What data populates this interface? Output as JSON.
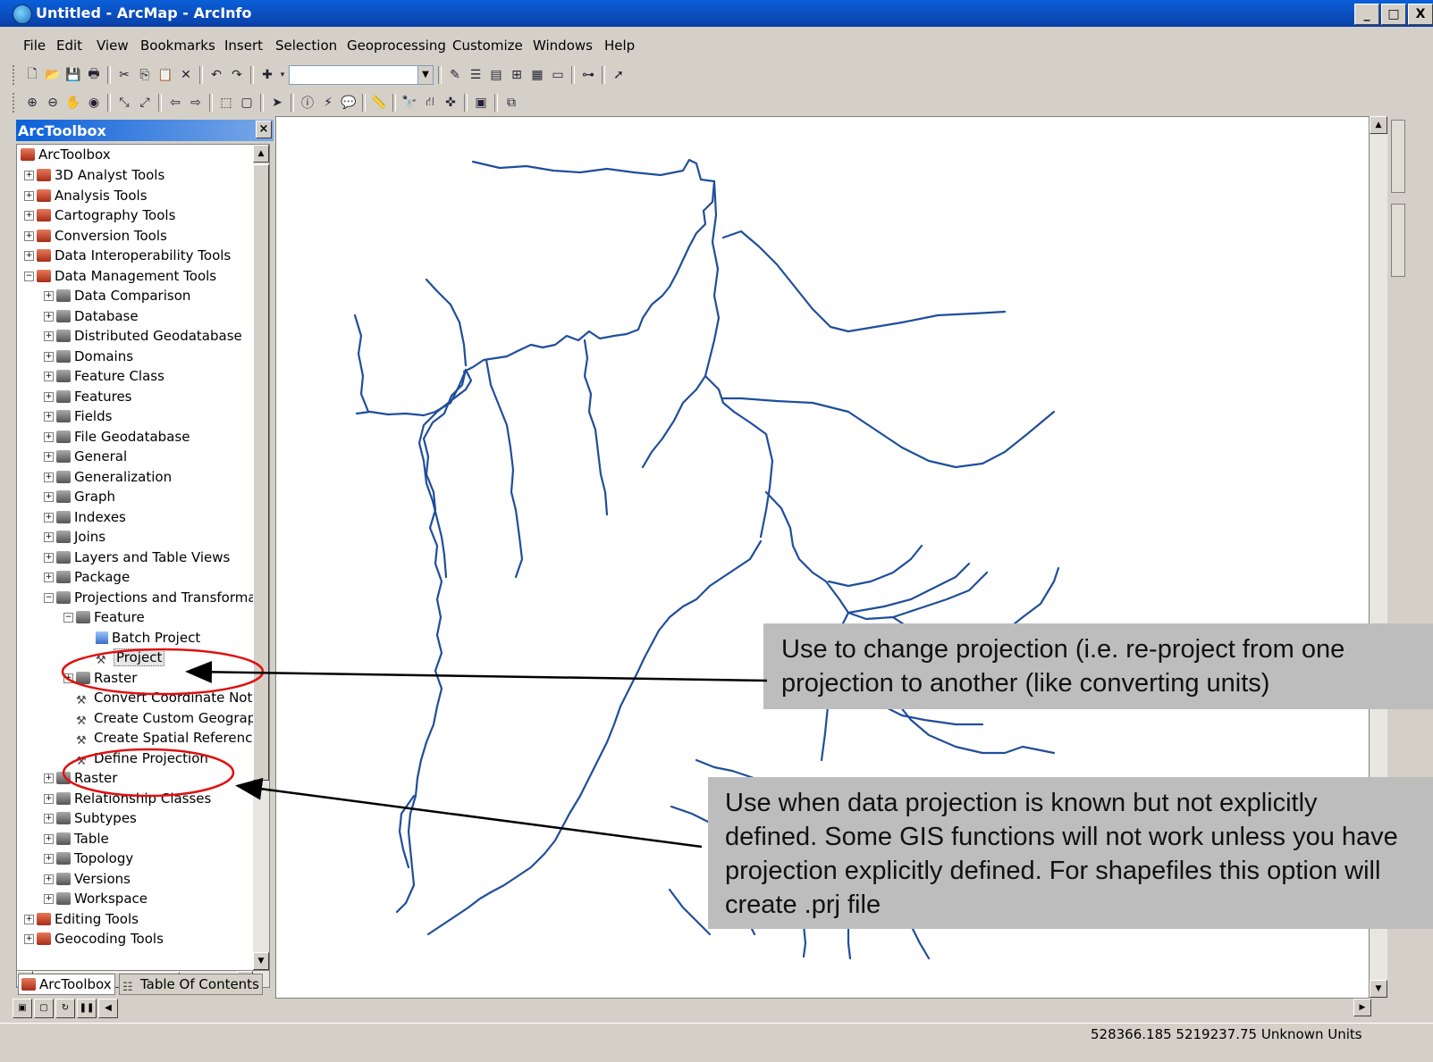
{
  "window": {
    "title": "Untitled - ArcMap - ArcInfo",
    "minimize": "_",
    "maximize": "□",
    "close": "X"
  },
  "menu": [
    "File",
    "Edit",
    "View",
    "Bookmarks",
    "Insert",
    "Selection",
    "Geoprocessing",
    "Customize",
    "Windows",
    "Help"
  ],
  "toolbox_panel": {
    "title": "ArcToolbox",
    "close": "×",
    "root": "ArcToolbox",
    "items": [
      {
        "label": "3D Analyst Tools",
        "level": 1,
        "kind": "toolbox",
        "exp": "+"
      },
      {
        "label": "Analysis Tools",
        "level": 1,
        "kind": "toolbox",
        "exp": "+"
      },
      {
        "label": "Cartography Tools",
        "level": 1,
        "kind": "toolbox",
        "exp": "+"
      },
      {
        "label": "Conversion Tools",
        "level": 1,
        "kind": "toolbox",
        "exp": "+"
      },
      {
        "label": "Data Interoperability Tools",
        "level": 1,
        "kind": "toolbox",
        "exp": "+"
      },
      {
        "label": "Data Management Tools",
        "level": 1,
        "kind": "toolbox",
        "exp": "−"
      },
      {
        "label": "Data Comparison",
        "level": 2,
        "kind": "toolset",
        "exp": "+"
      },
      {
        "label": "Database",
        "level": 2,
        "kind": "toolset",
        "exp": "+"
      },
      {
        "label": "Distributed Geodatabase",
        "level": 2,
        "kind": "toolset",
        "exp": "+"
      },
      {
        "label": "Domains",
        "level": 2,
        "kind": "toolset",
        "exp": "+"
      },
      {
        "label": "Feature Class",
        "level": 2,
        "kind": "toolset",
        "exp": "+"
      },
      {
        "label": "Features",
        "level": 2,
        "kind": "toolset",
        "exp": "+"
      },
      {
        "label": "Fields",
        "level": 2,
        "kind": "toolset",
        "exp": "+"
      },
      {
        "label": "File Geodatabase",
        "level": 2,
        "kind": "toolset",
        "exp": "+"
      },
      {
        "label": "General",
        "level": 2,
        "kind": "toolset",
        "exp": "+"
      },
      {
        "label": "Generalization",
        "level": 2,
        "kind": "toolset",
        "exp": "+"
      },
      {
        "label": "Graph",
        "level": 2,
        "kind": "toolset",
        "exp": "+"
      },
      {
        "label": "Indexes",
        "level": 2,
        "kind": "toolset",
        "exp": "+"
      },
      {
        "label": "Joins",
        "level": 2,
        "kind": "toolset",
        "exp": "+"
      },
      {
        "label": "Layers and Table Views",
        "level": 2,
        "kind": "toolset",
        "exp": "+"
      },
      {
        "label": "Package",
        "level": 2,
        "kind": "toolset",
        "exp": "+"
      },
      {
        "label": "Projections and Transforma",
        "level": 2,
        "kind": "toolset",
        "exp": "−"
      },
      {
        "label": "Feature",
        "level": 3,
        "kind": "toolset",
        "exp": "−"
      },
      {
        "label": "Batch Project",
        "level": 4,
        "kind": "batch",
        "exp": ""
      },
      {
        "label": "Project",
        "level": 4,
        "kind": "tool",
        "exp": "",
        "selected": true
      },
      {
        "label": "Raster",
        "level": 3,
        "kind": "toolset",
        "exp": "+"
      },
      {
        "label": "Convert Coordinate Not",
        "level": 3,
        "kind": "tool",
        "exp": ""
      },
      {
        "label": "Create Custom Geograp",
        "level": 3,
        "kind": "tool",
        "exp": ""
      },
      {
        "label": "Create Spatial Reference",
        "level": 3,
        "kind": "tool",
        "exp": ""
      },
      {
        "label": "Define Projection",
        "level": 3,
        "kind": "tool",
        "exp": ""
      },
      {
        "label": "Raster",
        "level": 2,
        "kind": "toolset",
        "exp": "+"
      },
      {
        "label": "Relationship Classes",
        "level": 2,
        "kind": "toolset",
        "exp": "+"
      },
      {
        "label": "Subtypes",
        "level": 2,
        "kind": "toolset",
        "exp": "+"
      },
      {
        "label": "Table",
        "level": 2,
        "kind": "toolset",
        "exp": "+"
      },
      {
        "label": "Topology",
        "level": 2,
        "kind": "toolset",
        "exp": "+"
      },
      {
        "label": "Versions",
        "level": 2,
        "kind": "toolset",
        "exp": "+"
      },
      {
        "label": "Workspace",
        "level": 2,
        "kind": "toolset",
        "exp": "+"
      },
      {
        "label": "Editing Tools",
        "level": 1,
        "kind": "toolbox",
        "exp": "+"
      },
      {
        "label": "Geocoding Tools",
        "level": 1,
        "kind": "toolbox",
        "exp": "+"
      }
    ],
    "tabs": [
      "ArcToolbox",
      "Table Of Contents"
    ]
  },
  "status": {
    "coordinates": "528366.185  5219237.75 Unknown Units"
  },
  "callouts": {
    "project": "Use to change projection (i.e. re-project from one projection to another (like converting units)",
    "define": "Use when data projection is known but not explicitly defined. Some GIS functions will not work unless you have projection explicitly defined. For shapefiles this option will create .prj file"
  },
  "colors": {
    "river": "#1f4e9a",
    "annotation_ellipse": "#e01010",
    "callout_bg": "#bdbdbd"
  }
}
